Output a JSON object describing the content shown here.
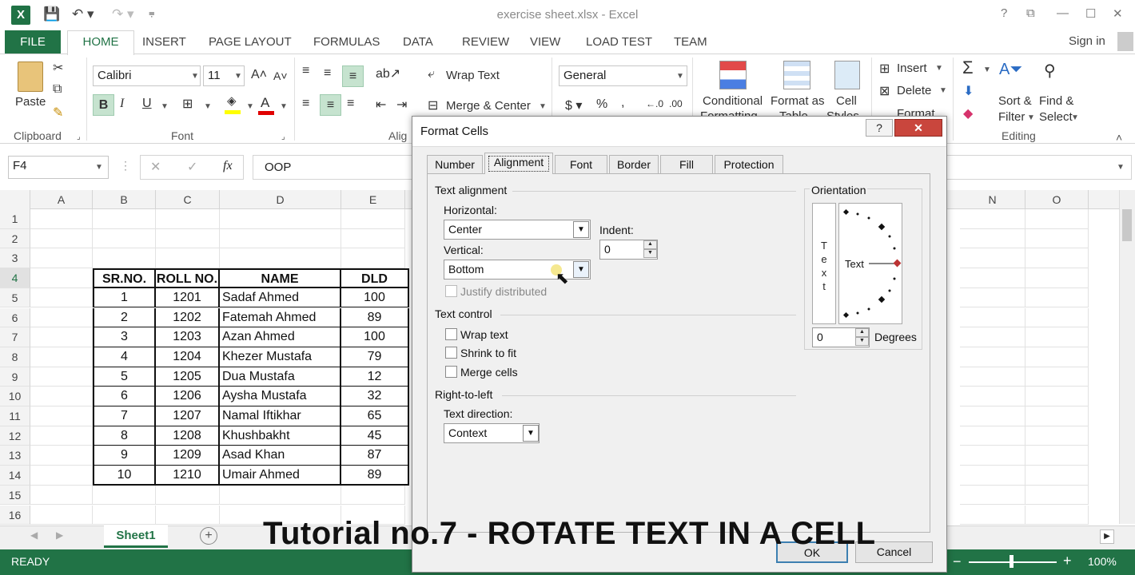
{
  "app": {
    "logo_letter": "X",
    "window_title": "exercise sheet.xlsx - Excel",
    "win_buttons": [
      "?",
      "⧉",
      "—",
      "☐",
      "✕"
    ]
  },
  "ribbon_tabs": {
    "file": "FILE",
    "home": "HOME",
    "others": [
      "INSERT",
      "PAGE LAYOUT",
      "FORMULAS",
      "DATA",
      "REVIEW",
      "VIEW",
      "LOAD TEST",
      "TEAM"
    ],
    "sign_in": "Sign in"
  },
  "ribbon": {
    "paste": "Paste",
    "clipboard": "Clipboard",
    "font_name": "Calibri",
    "font_size": "11",
    "font_group": "Font",
    "align_group": "Alig",
    "wrap_text": "Wrap Text",
    "merge_center": "Merge & Center",
    "number_format": "General",
    "conditional": "Conditional",
    "conditional2": "Formatting",
    "format_as": "Format as",
    "format_as2": "Table",
    "cell_styles": "Cell",
    "cell_styles2": "Styles",
    "insert": "Insert",
    "delete": "Delete",
    "format": "Format",
    "sort_filter": "Sort &",
    "sort_filter2": "Filter",
    "find_select": "Find &",
    "find_select2": "Select",
    "editing": "Editing"
  },
  "formula_bar": {
    "name_box": "F4",
    "fx": "fx",
    "value": "OOP"
  },
  "columns": [
    "A",
    "B",
    "C",
    "D",
    "E",
    "N",
    "O"
  ],
  "rows": [
    "1",
    "2",
    "3",
    "4",
    "5",
    "6",
    "7",
    "8",
    "9",
    "10",
    "11",
    "12",
    "13",
    "14",
    "15",
    "16"
  ],
  "table": {
    "headers": [
      "SR.NO.",
      "ROLL NO.",
      "NAME",
      "DLD"
    ],
    "data": [
      [
        "1",
        "1201",
        "Sadaf  Ahmed",
        "100"
      ],
      [
        "2",
        "1202",
        "Fatemah Ahmed",
        "89"
      ],
      [
        "3",
        "1203",
        "Azan Ahmed",
        "100"
      ],
      [
        "4",
        "1204",
        "Khezer Mustafa",
        "79"
      ],
      [
        "5",
        "1205",
        "Dua Mustafa",
        "12"
      ],
      [
        "6",
        "1206",
        "Aysha Mustafa",
        "32"
      ],
      [
        "7",
        "1207",
        "Namal Iftikhar",
        "65"
      ],
      [
        "8",
        "1208",
        "Khushbakht",
        "45"
      ],
      [
        "9",
        "1209",
        "Asad Khan",
        "87"
      ],
      [
        "10",
        "1210",
        "Umair Ahmed",
        "89"
      ]
    ]
  },
  "sheet_tab": "Sheet1",
  "status": {
    "ready": "READY",
    "zoom": "100%"
  },
  "dialog": {
    "title": "Format Cells",
    "help": "?",
    "close": "✕",
    "tabs": [
      "Number",
      "Alignment",
      "Font",
      "Border",
      "Fill",
      "Protection"
    ],
    "active_tab": "Alignment",
    "text_alignment": "Text alignment",
    "horizontal_label": "Horizontal:",
    "horizontal_value": "Center",
    "indent_label": "Indent:",
    "indent_value": "0",
    "vertical_label": "Vertical:",
    "vertical_value": "Bottom",
    "justify_distributed": "Justify distributed",
    "text_control": "Text control",
    "wrap_text": "Wrap text",
    "shrink_to_fit": "Shrink to fit",
    "merge_cells": "Merge cells",
    "rtl": "Right-to-left",
    "text_direction_label": "Text direction:",
    "text_direction_value": "Context",
    "orientation": "Orientation",
    "vertical_text": [
      "T",
      "e",
      "x",
      "t"
    ],
    "dial_text": "Text",
    "degrees_value": "0",
    "degrees_label": "Degrees",
    "ok": "OK",
    "cancel": "Cancel"
  },
  "caption": "Tutorial no.7 - ROTATE TEXT IN A CELL",
  "colors": {
    "excel_green": "#217346",
    "highlight": "#c6e3cf"
  }
}
